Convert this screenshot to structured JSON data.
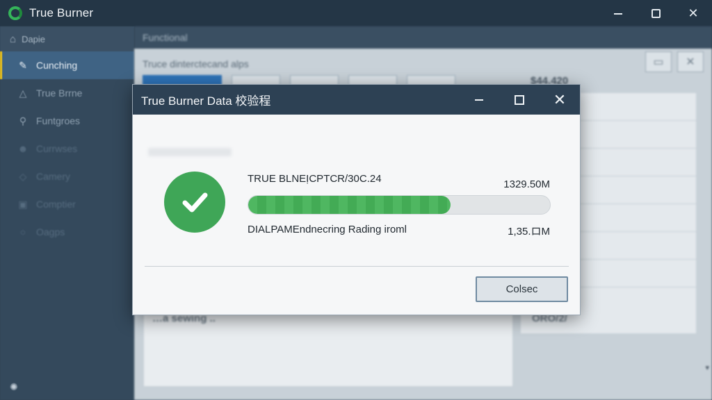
{
  "window": {
    "title": "True Burner",
    "controls": {
      "minimize": "–",
      "maximize": "☐",
      "close": "✕"
    }
  },
  "sidebar": {
    "header": {
      "icon": "home-icon",
      "label": "Dapie"
    },
    "items": [
      {
        "label": "Cunching",
        "icon": "tool-icon",
        "active": true
      },
      {
        "label": "True Brrne",
        "icon": "warning-icon",
        "active": false
      },
      {
        "label": "Funtgroes",
        "icon": "search-icon",
        "active": false
      },
      {
        "label": "Currwses",
        "icon": "users-icon",
        "active": false
      },
      {
        "label": "Camery",
        "icon": "tag-icon",
        "active": false
      },
      {
        "label": "Comptier",
        "icon": "computer-icon",
        "active": false
      },
      {
        "label": "Oagps",
        "icon": "chat-icon",
        "active": false
      }
    ],
    "footer_icon": "loading-icon"
  },
  "content": {
    "tab_label": "Functional",
    "subtitle": "Truce dinterctecand alps",
    "stat_value": "$44.420",
    "lower_left_text": "…a sewing ..",
    "lower_right_text": "ORO/2/",
    "scroll_indicator": "▾"
  },
  "dialog": {
    "title": "True Burner Data 校验程",
    "controls": {
      "minimize": "–",
      "maximize": "☐",
      "close": "✕"
    },
    "success_icon": "check-icon",
    "success_color": "#3fa657",
    "item_name": "TRUE BLNEỊCPTCR/30C.24",
    "item_size": "1329.50M",
    "progress_fraction": 0.67,
    "status_text": "DIALPAMEndnecring Rading iroml",
    "status_size": "1,35.ロM",
    "close_label": "Colsec"
  }
}
